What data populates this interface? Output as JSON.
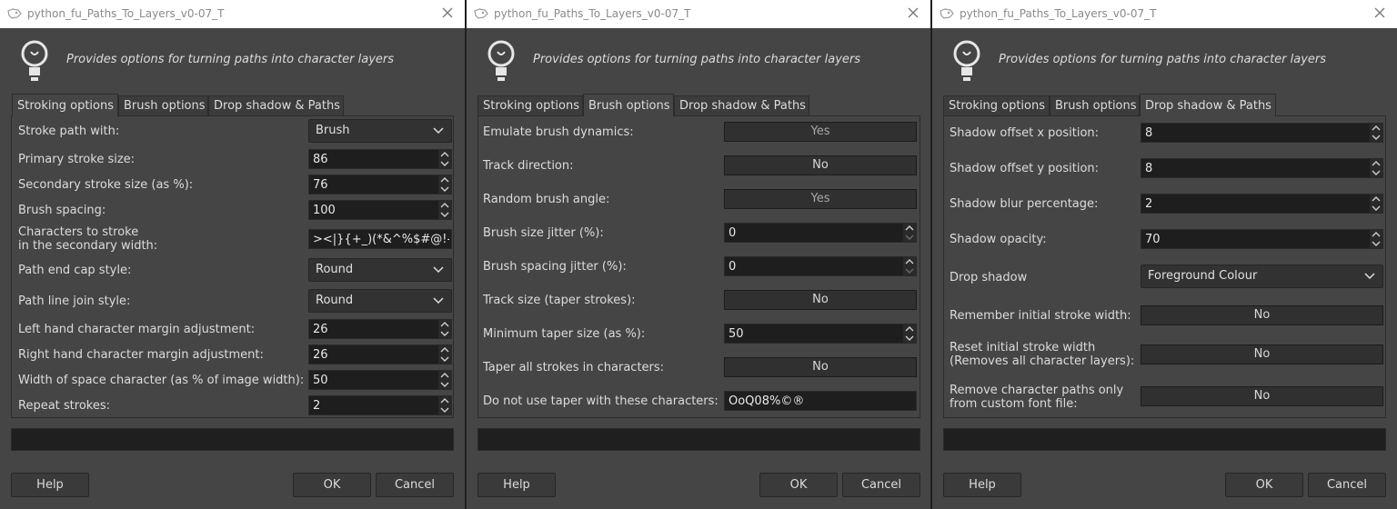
{
  "windows": [
    {
      "title": "python_fu_Paths_To_Layers_v0-07_T",
      "description": "Provides options for turning paths into character layers",
      "tabs": [
        "Stroking options",
        "Brush options",
        "Drop shadow & Paths"
      ],
      "active_tab": 0,
      "fields": {
        "stroke_path": {
          "label": "Stroke path with:",
          "value": "Brush"
        },
        "primary_size": {
          "label": "Primary stroke size:",
          "value": "86"
        },
        "secondary_size": {
          "label": "Secondary stroke size (as %):",
          "value": "76"
        },
        "brush_spacing": {
          "label": "Brush spacing:",
          "value": "100"
        },
        "chars_stroke": {
          "label_line1": "Characters to stroke",
          "label_line2": "in the secondary width:",
          "value": "><|}{+_)(*&^%$#@!-"
        },
        "end_cap": {
          "label": "Path end cap style:",
          "value": "Round"
        },
        "line_join": {
          "label": "Path line join style:",
          "value": "Round"
        },
        "left_margin": {
          "label": "Left hand character margin adjustment:",
          "value": "26"
        },
        "right_margin": {
          "label": "Right hand character margin adjustment:",
          "value": "26"
        },
        "space_width": {
          "label": "Width of space character (as % of image width):",
          "value": "50"
        },
        "repeat": {
          "label": "Repeat strokes:",
          "value": "2"
        }
      }
    },
    {
      "title": "python_fu_Paths_To_Layers_v0-07_T",
      "description": "Provides options for turning paths into character layers",
      "tabs": [
        "Stroking options",
        "Brush options",
        "Drop shadow & Paths"
      ],
      "active_tab": 1,
      "fields": {
        "emulate": {
          "label": "Emulate brush dynamics:",
          "value": "Yes"
        },
        "track_dir": {
          "label": "Track direction:",
          "value": "No"
        },
        "random_angle": {
          "label": "Random brush angle:",
          "value": "Yes"
        },
        "size_jitter": {
          "label": "Brush size jitter (%):",
          "value": "0"
        },
        "spacing_jitter": {
          "label": "Brush spacing jitter (%):",
          "value": "0"
        },
        "track_size": {
          "label": "Track size (taper strokes):",
          "value": "No"
        },
        "min_taper": {
          "label": "Minimum taper size (as %):",
          "value": "50"
        },
        "taper_all": {
          "label": "Taper all strokes in characters:",
          "value": "No"
        },
        "no_taper": {
          "label": "Do not use taper with these characters:",
          "value": "OoQ08%©®"
        }
      }
    },
    {
      "title": "python_fu_Paths_To_Layers_v0-07_T",
      "description": "Provides options for turning paths into character layers",
      "tabs": [
        "Stroking options",
        "Brush options",
        "Drop shadow & Paths"
      ],
      "active_tab": 2,
      "fields": {
        "offset_x": {
          "label": "Shadow offset x position:",
          "value": "8"
        },
        "offset_y": {
          "label": "Shadow offset y position:",
          "value": "8"
        },
        "blur": {
          "label": "Shadow blur percentage:",
          "value": "2"
        },
        "opacity": {
          "label": "Shadow opacity:",
          "value": "70"
        },
        "drop_shadow": {
          "label": "Drop shadow",
          "value": "Foreground Colour"
        },
        "remember": {
          "label": "Remember initial stroke width:",
          "value": "No"
        },
        "reset": {
          "label_line1": "Reset initial stroke width",
          "label_line2": "(Removes all character layers):",
          "value": "No"
        },
        "remove_paths": {
          "label_line1": "Remove character paths only",
          "label_line2": "from custom font file:",
          "value": "No"
        }
      }
    }
  ],
  "buttons": {
    "help": "Help",
    "ok": "OK",
    "cancel": "Cancel"
  }
}
